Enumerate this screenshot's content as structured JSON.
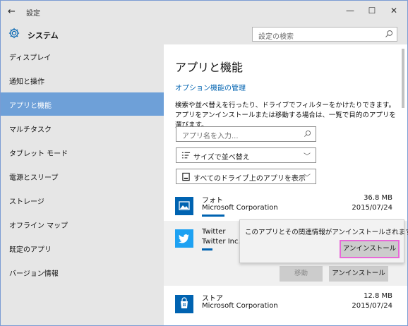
{
  "window": {
    "title": "設定",
    "back_glyph": "←",
    "minimize_glyph": "—",
    "maximize_glyph": "☐",
    "close_glyph": "✕"
  },
  "header": {
    "section_icon": "gear-icon",
    "section_label": "システム",
    "search_placeholder": "設定の検索"
  },
  "sidebar": {
    "items": [
      {
        "label": "ディスプレイ",
        "selected": false
      },
      {
        "label": "通知と操作",
        "selected": false
      },
      {
        "label": "アプリと機能",
        "selected": true
      },
      {
        "label": "マルチタスク",
        "selected": false
      },
      {
        "label": "タブレット モード",
        "selected": false
      },
      {
        "label": "電源とスリープ",
        "selected": false
      },
      {
        "label": "ストレージ",
        "selected": false
      },
      {
        "label": "オフライン マップ",
        "selected": false
      },
      {
        "label": "既定のアプリ",
        "selected": false
      },
      {
        "label": "バージョン情報",
        "selected": false
      }
    ]
  },
  "main": {
    "title": "アプリと機能",
    "optional_features_link": "オプション機能の管理",
    "description": "検索や並べ替えを行ったり、ドライブでフィルターをかけたりできます。アプリをアンインストールまたは移動する場合は、一覧で目的のアプリを選びます。",
    "filter_placeholder": "アプリ名を入力...",
    "sort_label": "サイズで並べ替え",
    "drive_label": "すべてのドライブ上のアプリを表示",
    "apps": [
      {
        "name": "フォト",
        "publisher": "Microsoft Corporation",
        "size": "36.8 MB",
        "date": "2015/07/24",
        "icon": "photos-icon"
      },
      {
        "name": "Twitter",
        "publisher": "Twitter Inc.",
        "size": "",
        "date": "",
        "icon": "twitter-icon"
      },
      {
        "name": "ストア",
        "publisher": "Microsoft Corporation",
        "size": "12.8 MB",
        "date": "2015/07/24",
        "icon": "store-icon"
      }
    ],
    "popup": {
      "message": "このアプリとその関連情報がアンインストールされます。",
      "confirm_label": "アンインストール"
    },
    "move_label": "移動",
    "uninstall_label": "アンインストール"
  },
  "colors": {
    "accent": "#0063b1",
    "selected_nav": "#6ea0d8",
    "highlight_border": "#e868d8"
  }
}
